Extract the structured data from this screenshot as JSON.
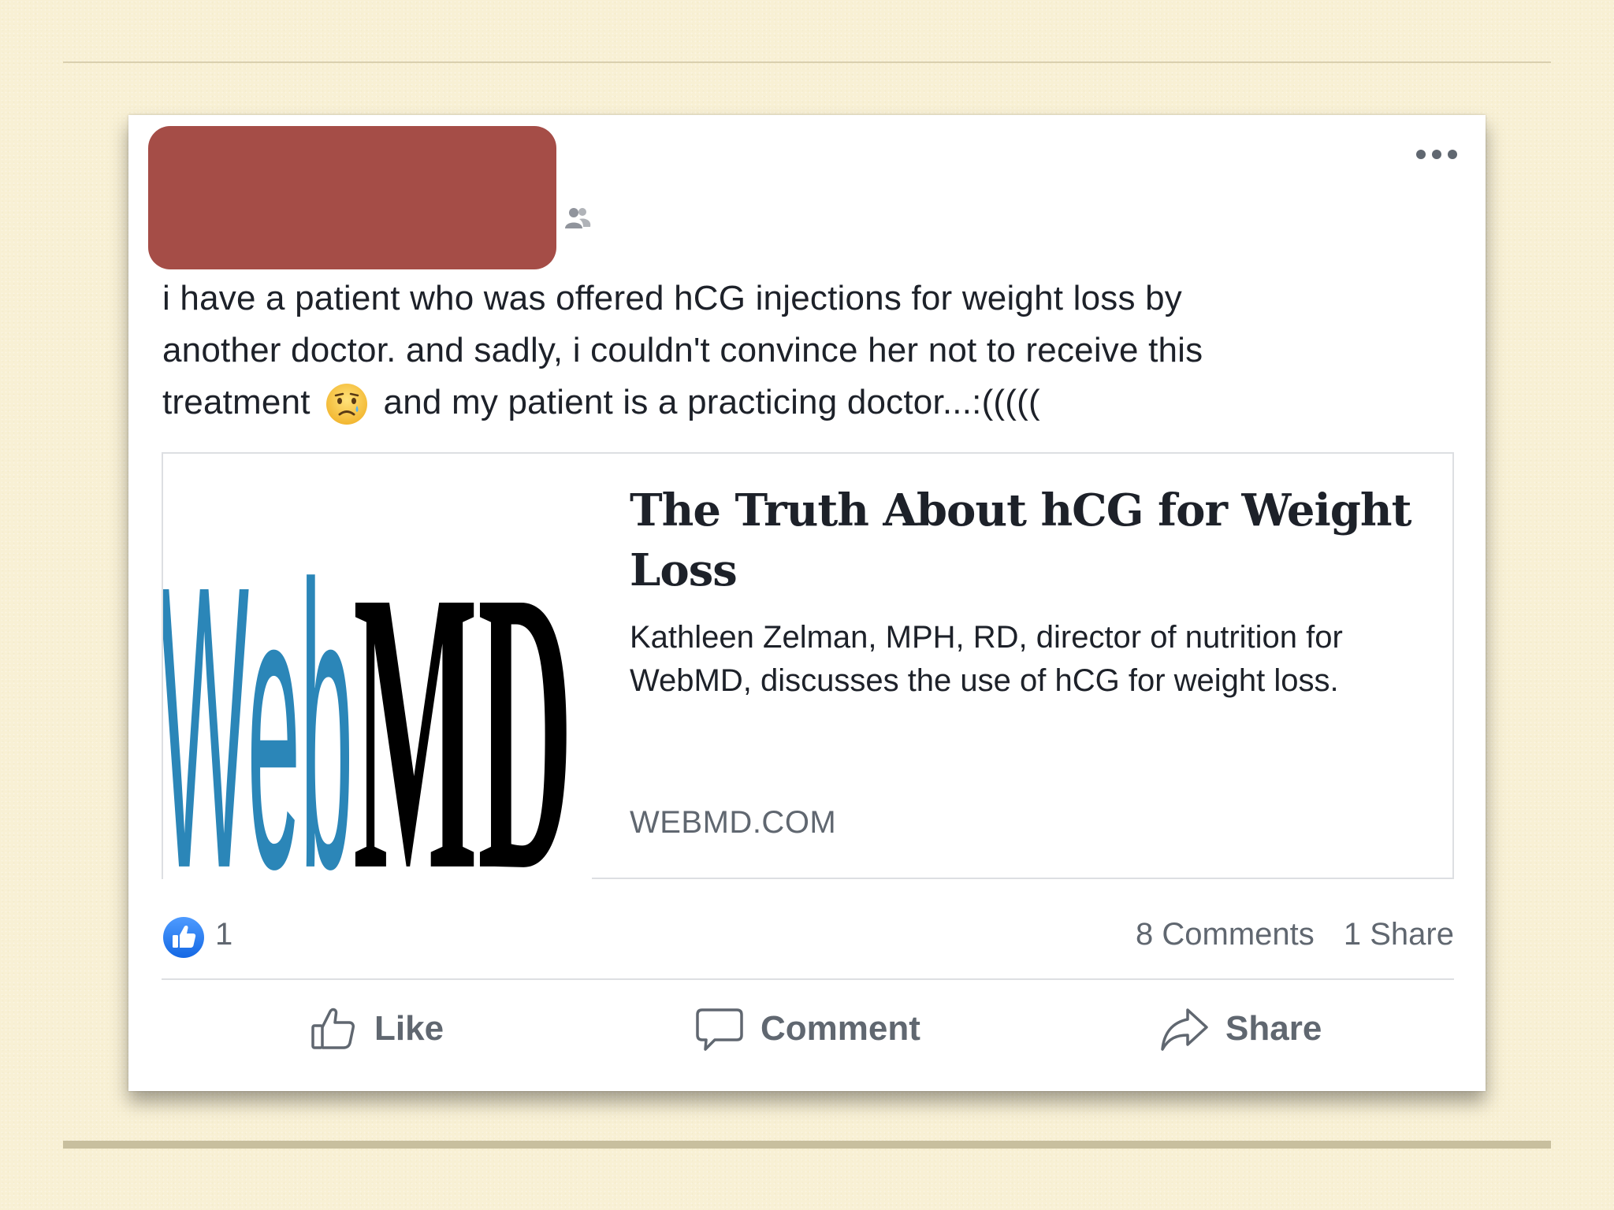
{
  "post": {
    "text_line1": "i have a patient who was offered hCG injections for weight loss by",
    "text_line2": "another doctor. and sadly, i couldn't convince her not to receive this",
    "text_line3a": "treatment",
    "text_line3b": "and my patient is a practicing doctor...:(((((",
    "emoji_icon": "sad-face-emoji",
    "audience_icon": "friends-icon",
    "menu_icon": "more-options-icon"
  },
  "link_preview": {
    "thumbnail_text_blue": "Web",
    "thumbnail_text_black": "MD",
    "title": "The Truth About hCG for Weight Loss",
    "description": "Kathleen Zelman, MPH, RD, director of nutrition for WebMD, discusses the use of hCG for weight loss.",
    "domain": "WEBMD.COM"
  },
  "stats": {
    "like_count": "1",
    "comments": "8 Comments",
    "shares": "1 Share"
  },
  "actions": {
    "like": "Like",
    "comment": "Comment",
    "share": "Share"
  },
  "colors": {
    "background": "#f8f0d4",
    "redaction": "#a54d47",
    "facebook_blue": "#1877f2",
    "secondary_text": "#606770",
    "webmd_blue": "#2b86b8"
  }
}
